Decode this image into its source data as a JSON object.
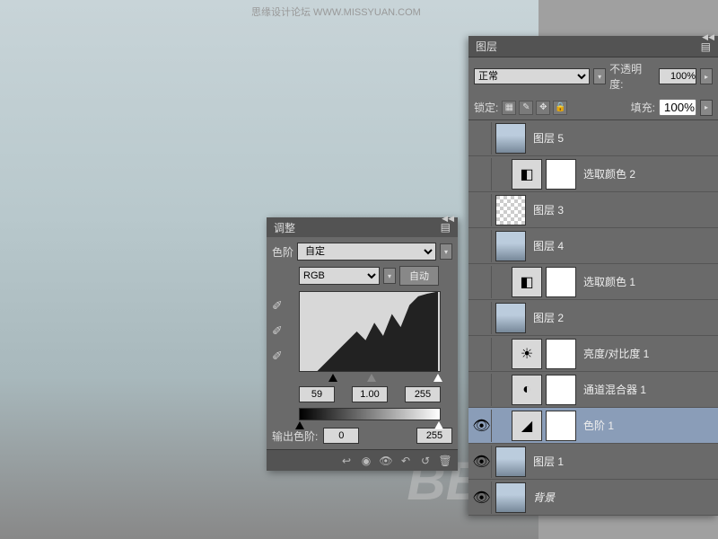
{
  "watermark": {
    "top": "思缘设计论坛  WWW.MISSYUAN.COM",
    "big": "BBS"
  },
  "layers_panel": {
    "title": "图层",
    "blend_label": "",
    "blend_mode": "正常",
    "opacity_label": "不透明度:",
    "opacity_value": "100%",
    "lock_label": "锁定:",
    "fill_label": "填充:",
    "fill_value": "100%",
    "layers": [
      {
        "name": "图层 5",
        "type": "photo",
        "visible": false
      },
      {
        "name": "选取颜色 2",
        "type": "adj",
        "mask": true,
        "visible": false,
        "indent": true
      },
      {
        "name": "图层 3",
        "type": "empty",
        "visible": false
      },
      {
        "name": "图层 4",
        "type": "photo",
        "visible": false
      },
      {
        "name": "选取颜色 1",
        "type": "adj",
        "mask": true,
        "visible": false,
        "indent": true
      },
      {
        "name": "图层 2",
        "type": "photo",
        "visible": false
      },
      {
        "name": "亮度/对比度 1",
        "type": "adj",
        "mask": true,
        "visible": false,
        "indent": true
      },
      {
        "name": "通道混合器 1",
        "type": "adj",
        "mask": true,
        "visible": false,
        "indent": true
      },
      {
        "name": "色阶 1",
        "type": "adj",
        "mask": true,
        "visible": true,
        "indent": true,
        "selected": true
      },
      {
        "name": "图层 1",
        "type": "photo",
        "visible": true
      },
      {
        "name": "背景",
        "type": "photo",
        "visible": true,
        "italic": true
      }
    ]
  },
  "adjustments_panel": {
    "title": "调整",
    "type_label": "色阶",
    "preset": "自定",
    "channel": "RGB",
    "auto_btn": "自动",
    "input_black": "59",
    "input_gamma": "1.00",
    "input_white": "255",
    "output_label": "输出色阶:",
    "output_black": "0",
    "output_white": "255"
  }
}
